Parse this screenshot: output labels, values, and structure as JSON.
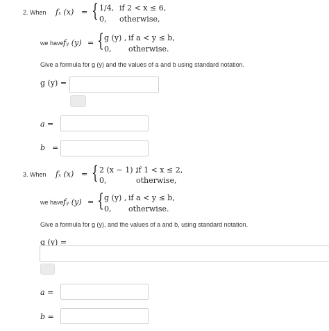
{
  "q2": {
    "number": "2. When",
    "fx": "fₓ (x)",
    "eq": "=",
    "case1_value": "1/4,",
    "case1_condition": "if 2 < x ≤ 6,",
    "case2_value": "0,",
    "case2_condition": "otherwise,",
    "we_have": "we have",
    "fy": "fᵧ (y)",
    "fy_case1_value": "g (y) ,",
    "fy_case1_condition": "if a < y ≤ b,",
    "fy_case2_value": "0,",
    "fy_case2_condition": "otherwise.",
    "instruction": "Give a formula for g (y) and the values of a and b using standard notation.",
    "g_label": "g (y) =",
    "g_value": "",
    "a_label": "a =",
    "a_value": "",
    "b_label": "b",
    "b_eq": "=",
    "b_value": ""
  },
  "q3": {
    "number": "3. When",
    "fx": "fₓ (x)",
    "eq": "=",
    "case1_value": "2 (x − 1) ,",
    "case1_condition": "if 1 < x ≤ 2,",
    "case2_value": "0,",
    "case2_condition": "otherwise,",
    "we_have": "we have",
    "fy": "fᵧ (y)",
    "fy_case1_value": "g (y) ,",
    "fy_case1_condition": "if a < y ≤ b,",
    "fy_case2_value": "0,",
    "fy_case2_condition": "otherwise.",
    "instruction": "Give a formula for g (y), and the values of a and b, using standard notation.",
    "g_label": "g (y) =",
    "g_value": "",
    "a_label": "a =",
    "a_value": "",
    "b_label": "b =",
    "b_value": ""
  }
}
